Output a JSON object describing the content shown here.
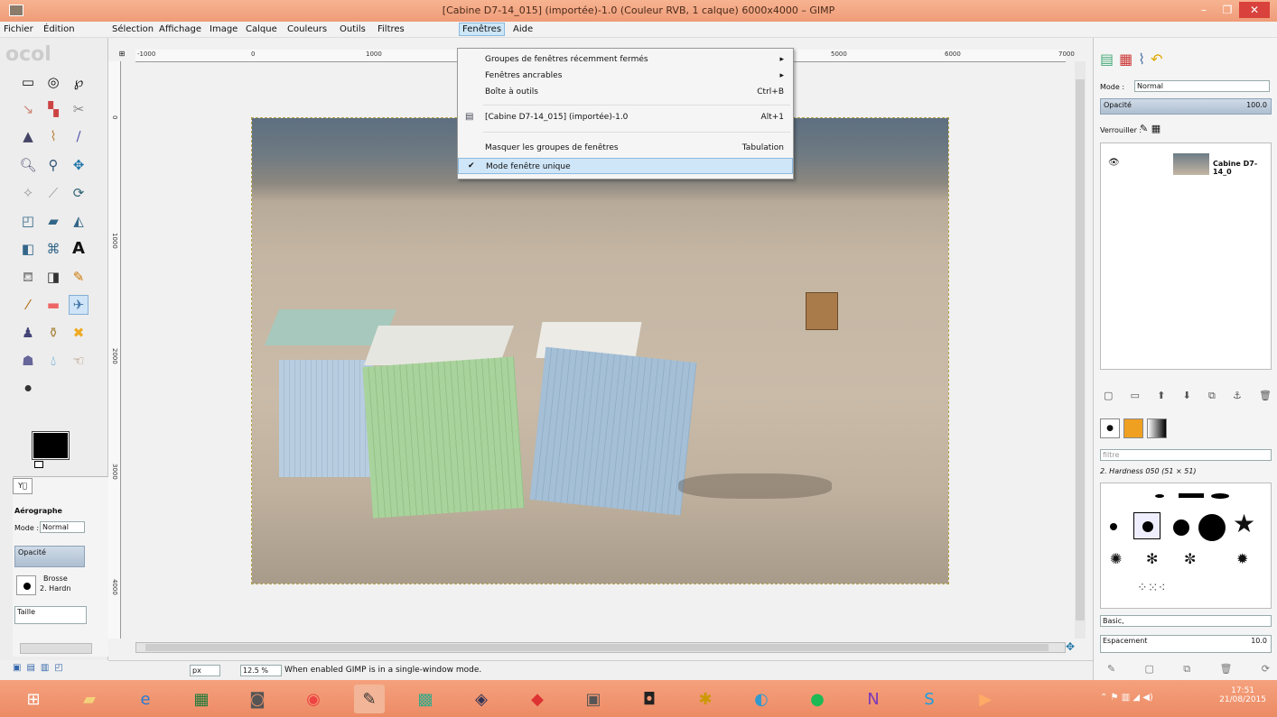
{
  "window": {
    "title": "[Cabine D7-14_015] (importée)-1.0 (Couleur RVB, 1 calque) 6000x4000 – GIMP"
  },
  "menubar": [
    "Fichier",
    "Édition",
    "Sélection",
    "Affichage",
    "Image",
    "Calque",
    "Couleurs",
    "Outils",
    "Filtres",
    "Fenêtres",
    "Aide"
  ],
  "fenetres_menu": {
    "items": [
      {
        "label": "Groupes de fenêtres récemment fermés",
        "accel": "▸"
      },
      {
        "label": "Fenêtres ancrables",
        "accel": "▸"
      },
      {
        "label": "Boîte à outils",
        "accel": "Ctrl+B"
      },
      {
        "label": "[Cabine D7-14_015] (importée)-1.0",
        "accel": "Alt+1"
      },
      {
        "label": "Masquer les groupes de fenêtres",
        "accel": "Tabulation"
      },
      {
        "label": "Mode fenêtre unique",
        "accel": ""
      }
    ],
    "checked_item": "Mode fenêtre unique"
  },
  "rulers": {
    "h": [
      "-1000",
      "0",
      "1000",
      "5000",
      "6000",
      "7000"
    ],
    "v": [
      "0",
      "1000",
      "2000",
      "3000",
      "4000"
    ]
  },
  "tool_options": {
    "title": "Aérographe",
    "mode_label": "Mode :",
    "mode_value": "Normal",
    "opacity_label": "Opacité",
    "brush_label": "Brosse",
    "brush_value": "2. Hardn",
    "size_label": "Taille"
  },
  "layers": {
    "mode_label": "Mode :",
    "mode_value": "Normal",
    "opacity_label": "Opacité",
    "opacity_value": "100.0",
    "lock_label": "Verrouiller :",
    "layer_name": "Cabine D7-14_0"
  },
  "brushes": {
    "filter_placeholder": "filtre",
    "brush_name": "2. Hardness 050 (51 × 51)",
    "preset": "Basic,",
    "spacing_label": "Espacement",
    "spacing_value": "10.0"
  },
  "status": {
    "unit": "px",
    "zoom": "12.5 %",
    "message": "When enabled GIMP is in a single-window mode."
  },
  "clock": {
    "time": "17:51",
    "date": "21/08/2015"
  }
}
